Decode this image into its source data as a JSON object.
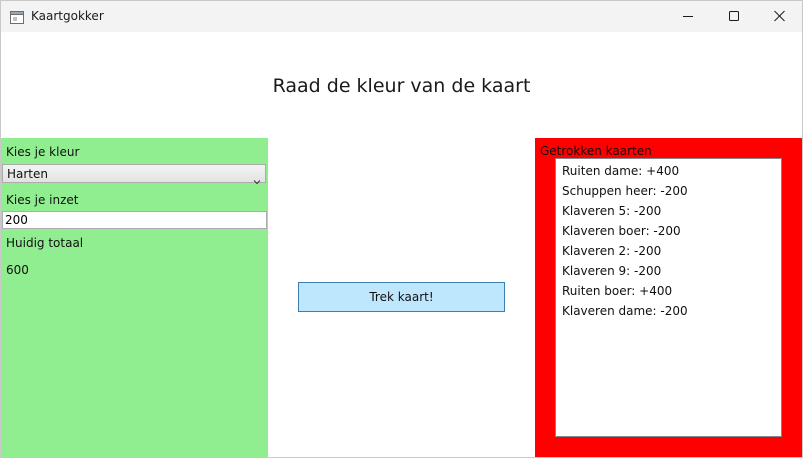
{
  "window": {
    "title": "Kaartgokker",
    "icons": {
      "app": "window-app-icon",
      "minimize": "minimize-icon",
      "maximize": "maximize-icon",
      "close": "close-icon"
    }
  },
  "heading": "Raad de kleur van de kaart",
  "left_panel": {
    "background": "#90ee90",
    "color_label": "Kies je kleur",
    "color_value": "Harten",
    "bet_label": "Kies je inzet",
    "bet_value": "200",
    "total_label": "Huidig totaal",
    "total_value": "600"
  },
  "draw_button": {
    "label": "Trek kaart!",
    "background": "#bee6fd"
  },
  "right_panel": {
    "background": "#ff0000",
    "label": "Getrokken kaarten",
    "cards": [
      "Ruiten dame: +400",
      "Schuppen heer: -200",
      "Klaveren 5: -200",
      "Klaveren boer: -200",
      "Klaveren 2: -200",
      "Klaveren 9: -200",
      "Ruiten boer: +400",
      "Klaveren dame: -200"
    ]
  }
}
